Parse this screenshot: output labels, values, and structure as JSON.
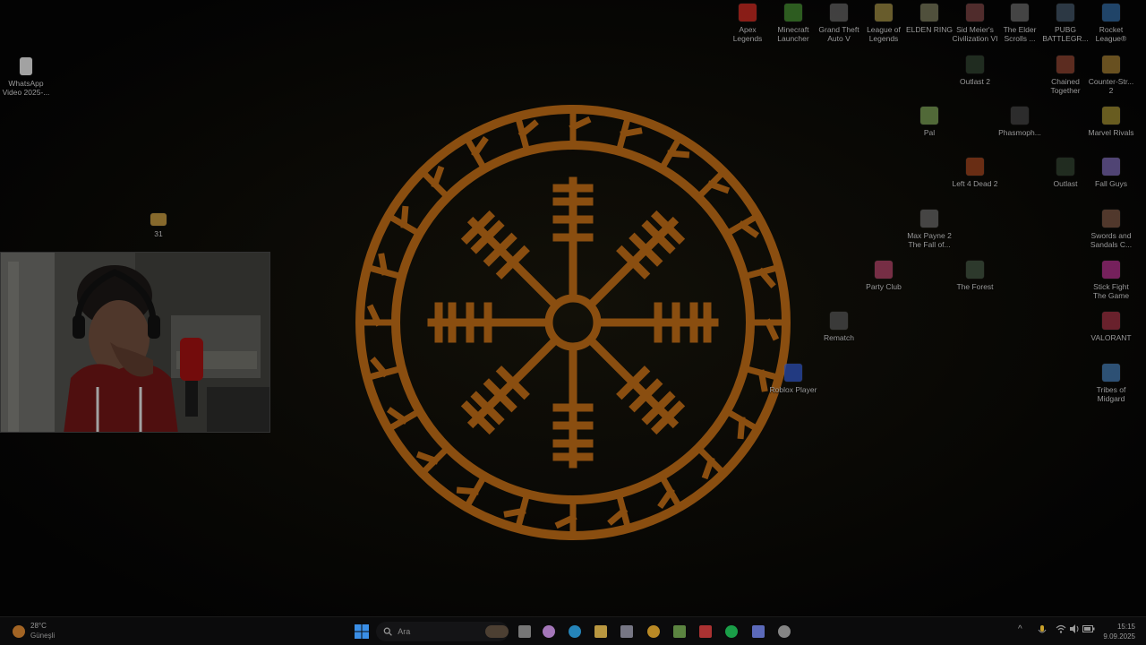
{
  "desktop": {
    "left_icons": [
      {
        "label": "WhatsApp\nVideo 2025-...",
        "icon": "video-file-icon"
      },
      {
        "label": "31",
        "icon": "folder-icon"
      }
    ],
    "icons": [
      {
        "label": "Apex\nLegends",
        "icon": "apex-legends-icon",
        "color": "#b5261e"
      },
      {
        "label": "Minecraft\nLauncher",
        "icon": "minecraft-icon",
        "color": "#3b7a2a"
      },
      {
        "label": "Grand Theft\nAuto V",
        "icon": "gta-v-icon",
        "color": "#555555"
      },
      {
        "label": "League of\nLegends",
        "icon": "league-of-legends-icon",
        "color": "#8a7a3a"
      },
      {
        "label": "ELDEN RING",
        "icon": "elden-ring-icon",
        "color": "#6a6a50"
      },
      {
        "label": "Sid Meier's\nCivilization VI",
        "icon": "civilization-vi-icon",
        "color": "#6a3a3a"
      },
      {
        "label": "The Elder\nScrolls ...",
        "icon": "elder-scrolls-icon",
        "color": "#5a5a5a"
      },
      {
        "label": "PUBG\nBATTLEGR...",
        "icon": "pubg-icon",
        "color": "#3a4a5a"
      },
      {
        "label": "Rocket\nLeague®",
        "icon": "rocket-league-icon",
        "color": "#2a5a8a"
      },
      {
        "label": "Outlast 2",
        "icon": "outlast-2-icon",
        "color": "#2a3a2a"
      },
      {
        "label": "Chained\nTogether",
        "icon": "chained-together-icon",
        "color": "#7a3a2a"
      },
      {
        "label": "Counter-Str...\n2",
        "icon": "counter-strike-2-icon",
        "color": "#8a6a2a"
      },
      {
        "label": "Pal",
        "icon": "palworld-icon",
        "color": "#6a8a4a"
      },
      {
        "label": "Phasmoph...",
        "icon": "phasmophobia-icon",
        "color": "#3a3a3a"
      },
      {
        "label": "Marvel Rivals",
        "icon": "marvel-rivals-icon",
        "color": "#8a7a2a"
      },
      {
        "label": "Left 4 Dead 2",
        "icon": "left-4-dead-2-icon",
        "color": "#8a3a1a"
      },
      {
        "label": "Outlast",
        "icon": "outlast-icon",
        "color": "#2a3a2a"
      },
      {
        "label": "Fall Guys",
        "icon": "fall-guys-icon",
        "color": "#6a5a9a"
      },
      {
        "label": "Max Payne 2\nThe Fall of...",
        "icon": "max-payne-2-icon",
        "color": "#5a5a5a"
      },
      {
        "label": "Swords and\nSandals C...",
        "icon": "swords-and-sandals-icon",
        "color": "#6a4a3a"
      },
      {
        "label": "Party Club",
        "icon": "party-club-icon",
        "color": "#9a3a5a"
      },
      {
        "label": "The Forest",
        "icon": "the-forest-icon",
        "color": "#3a4a3a"
      },
      {
        "label": "Stick Fight\nThe Game",
        "icon": "stick-fight-icon",
        "color": "#9a2a7a"
      },
      {
        "label": "Rematch",
        "icon": "rematch-icon",
        "color": "#4a4a4a"
      },
      {
        "label": "VALORANT",
        "icon": "valorant-icon",
        "color": "#8a2a3a"
      },
      {
        "label": "Roblox Player",
        "icon": "roblox-icon",
        "color": "#2a4aaa"
      },
      {
        "label": "Tribes of\nMidgard",
        "icon": "tribes-of-midgard-icon",
        "color": "#3a6a9a"
      }
    ]
  },
  "webcam": {
    "label": "webcam-overlay"
  },
  "taskbar": {
    "weather": {
      "temp": "28°C",
      "condition": "Güneşli",
      "icon": "weather-sun-icon"
    },
    "search_placeholder": "Ara",
    "apps": [
      {
        "icon": "start-windows-icon",
        "color": "#3a8ee6"
      },
      {
        "icon": "task-view-icon",
        "color": "#8a8a8a"
      },
      {
        "icon": "copilot-icon",
        "color": "#c08ad8"
      },
      {
        "icon": "edge-icon",
        "color": "#2a9ad8"
      },
      {
        "icon": "file-explorer-icon",
        "color": "#d8b04a"
      },
      {
        "icon": "microsoft-store-icon",
        "color": "#8a8a9a"
      },
      {
        "icon": "chrome-icon",
        "color": "#d8a02a"
      },
      {
        "icon": "notepad-plus-icon",
        "color": "#6a9a4a"
      },
      {
        "icon": "red-app-icon",
        "color": "#c83a3a"
      },
      {
        "icon": "spotify-icon",
        "color": "#1db954"
      },
      {
        "icon": "discord-icon",
        "color": "#6a7ad8"
      },
      {
        "icon": "obs-icon",
        "color": "#9a9a9a"
      }
    ],
    "tray": {
      "chevron": "^",
      "clock_time": "15:15",
      "clock_date": "9.09.2025"
    }
  }
}
